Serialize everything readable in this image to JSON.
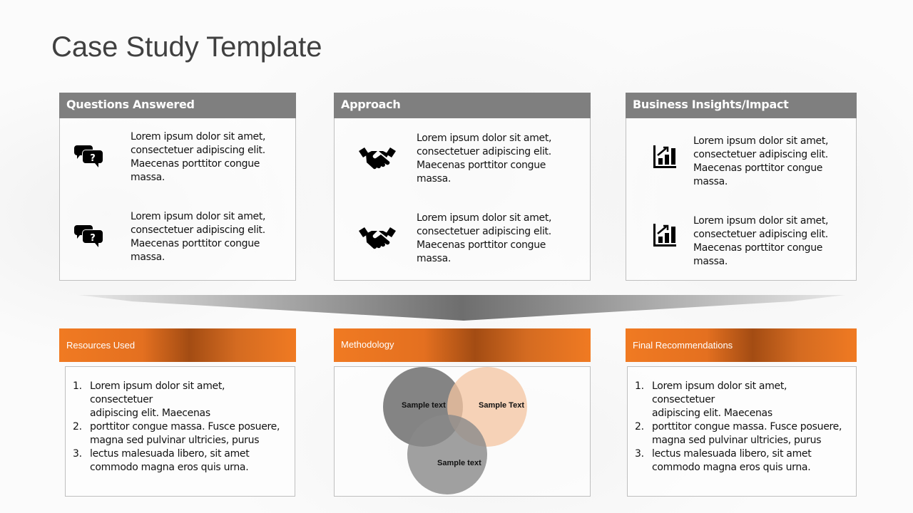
{
  "title": "Case Study Template",
  "top_sections": [
    {
      "header": "Questions Answered",
      "icon": "speech-bubbles-question-icon",
      "items": [
        {
          "lines": [
            "Lorem ipsum dolor sit amet,",
            "consectetuer adipiscing elit.",
            "Maecenas porttitor congue",
            "massa."
          ]
        },
        {
          "lines": [
            "Lorem ipsum dolor sit amet,",
            "consectetuer adipiscing elit.",
            "Maecenas porttitor congue",
            "massa."
          ]
        }
      ]
    },
    {
      "header": "Approach",
      "icon": "handshake-icon",
      "items": [
        {
          "lines": [
            "Lorem ipsum dolor sit amet,",
            "consectetuer adipiscing elit.",
            "Maecenas porttitor congue",
            "massa."
          ]
        },
        {
          "lines": [
            "Lorem ipsum dolor sit amet,",
            "consectetuer adipiscing elit.",
            "Maecenas porttitor congue",
            "massa."
          ]
        }
      ]
    },
    {
      "header": "Business Insights/Impact",
      "icon": "bar-chart-growth-icon",
      "items": [
        {
          "lines": [
            "Lorem ipsum dolor sit amet,",
            "consectetuer adipiscing elit.",
            "Maecenas porttitor congue",
            "massa."
          ]
        },
        {
          "lines": [
            "Lorem ipsum dolor sit amet,",
            "consectetuer adipiscing elit.",
            "Maecenas porttitor congue",
            "massa."
          ]
        }
      ]
    }
  ],
  "bottom_sections": {
    "resources": {
      "header": "Resources Used",
      "list": [
        {
          "num": "1.",
          "lines": [
            "Lorem ipsum dolor sit amet, consectetuer",
            "adipiscing elit. Maecenas"
          ]
        },
        {
          "num": "2.",
          "lines": [
            "porttitor congue massa. Fusce posuere,",
            "magna sed pulvinar ultricies, purus"
          ]
        },
        {
          "num": "3.",
          "lines": [
            "lectus malesuada libero, sit amet",
            "commodo  magna eros quis urna."
          ]
        }
      ]
    },
    "methodology": {
      "header": "Methodology",
      "venn": [
        {
          "label": "Sample text",
          "color": "#6f6f6f"
        },
        {
          "label": "Sample Text",
          "color": "#f4c4a0"
        },
        {
          "label": "Sample text",
          "color": "#8a8a8a"
        }
      ]
    },
    "recommendations": {
      "header": "Final Recommendations",
      "list": [
        {
          "num": "1.",
          "lines": [
            "Lorem ipsum dolor sit amet, consectetuer",
            "adipiscing elit. Maecenas"
          ]
        },
        {
          "num": "2.",
          "lines": [
            "porttitor congue massa. Fusce posuere,",
            "magna sed pulvinar ultricies, purus"
          ]
        },
        {
          "num": "3.",
          "lines": [
            "lectus malesuada libero, sit amet",
            "commodo  magna eros quis urna."
          ]
        }
      ]
    }
  },
  "colors": {
    "header_gray": "#7f7f7f",
    "accent_orange": "#f07a22",
    "accent_dark_orange": "#a34c13",
    "title_text": "#404040"
  }
}
